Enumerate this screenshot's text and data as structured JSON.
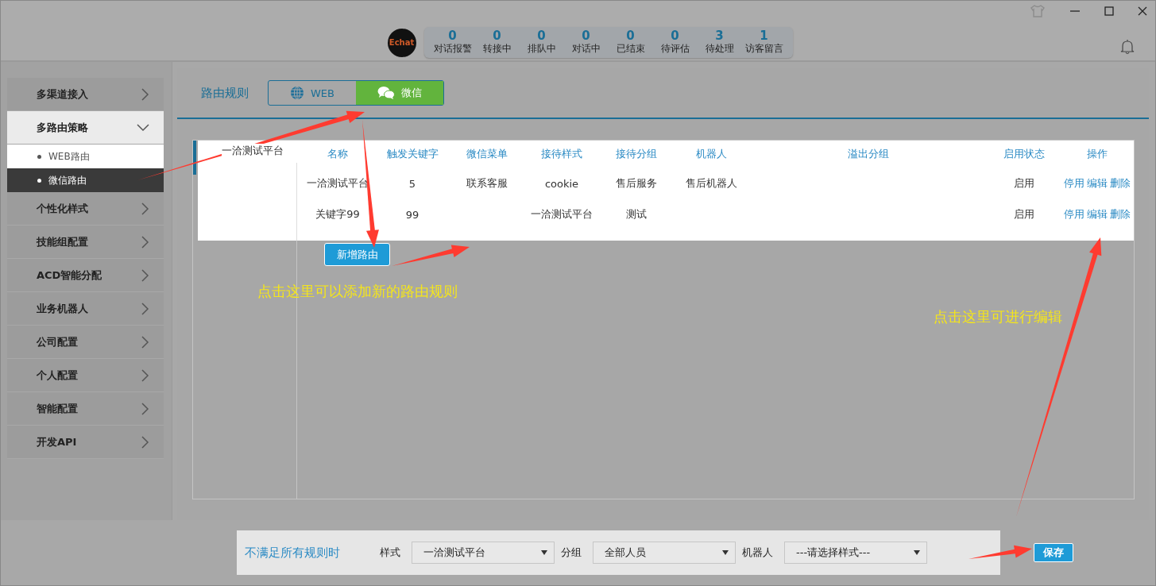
{
  "header": {
    "logo": "Echat",
    "stats": [
      {
        "count": "0",
        "label": "对话报警"
      },
      {
        "count": "0",
        "label": "转接中"
      },
      {
        "count": "0",
        "label": "排队中"
      },
      {
        "count": "0",
        "label": "对话中"
      },
      {
        "count": "0",
        "label": "已结束"
      },
      {
        "count": "0",
        "label": "待评估"
      },
      {
        "count": "3",
        "label": "待处理"
      },
      {
        "count": "1",
        "label": "访客留言"
      }
    ]
  },
  "sidebar": {
    "items": [
      {
        "label": "多渠道接入",
        "expanded": false
      },
      {
        "label": "多路由策略",
        "expanded": true,
        "children": [
          {
            "label": "WEB路由",
            "selected": false
          },
          {
            "label": "微信路由",
            "selected": true
          }
        ]
      },
      {
        "label": "个性化样式",
        "expanded": false
      },
      {
        "label": "技能组配置",
        "expanded": false
      },
      {
        "label": "ACD智能分配",
        "expanded": false
      },
      {
        "label": "业务机器人",
        "expanded": false
      },
      {
        "label": "公司配置",
        "expanded": false
      },
      {
        "label": "个人配置",
        "expanded": false
      },
      {
        "label": "智能配置",
        "expanded": false
      },
      {
        "label": "开发API",
        "expanded": false
      }
    ]
  },
  "main": {
    "title": "路由规则",
    "tabs": [
      {
        "label": "WEB",
        "kind": "web",
        "selected": false
      },
      {
        "label": "微信",
        "kind": "wechat",
        "selected": true
      }
    ],
    "group": "一洽测试平台",
    "table": {
      "columns": [
        "名称",
        "触发关键字",
        "微信菜单",
        "接待样式",
        "接待分组",
        "机器人",
        "溢出分组",
        "启用状态",
        "操作"
      ],
      "rows": [
        {
          "cells": [
            "一洽测试平台",
            "5",
            "联系客服",
            "cookie",
            "售后服务",
            "售后机器人",
            "",
            "启用"
          ],
          "actions": [
            "停用",
            "编辑",
            "删除"
          ]
        },
        {
          "cells": [
            "关键字99",
            "99",
            "",
            "一洽测试平台",
            "测试",
            "",
            "",
            "启用"
          ],
          "actions": [
            "停用",
            "编辑",
            "删除"
          ]
        }
      ]
    },
    "add_button": "新增路由"
  },
  "footer": {
    "label": "不满足所有规则时",
    "selects": [
      {
        "label": "样式",
        "value": "一洽测试平台"
      },
      {
        "label": "分组",
        "value": "全部人员"
      },
      {
        "label": "机器人",
        "value": "---请选择样式---"
      }
    ],
    "save_button": "保存"
  },
  "annotations": [
    "点击这里可以添加新的路由规则",
    "点击这里可进行编辑"
  ]
}
